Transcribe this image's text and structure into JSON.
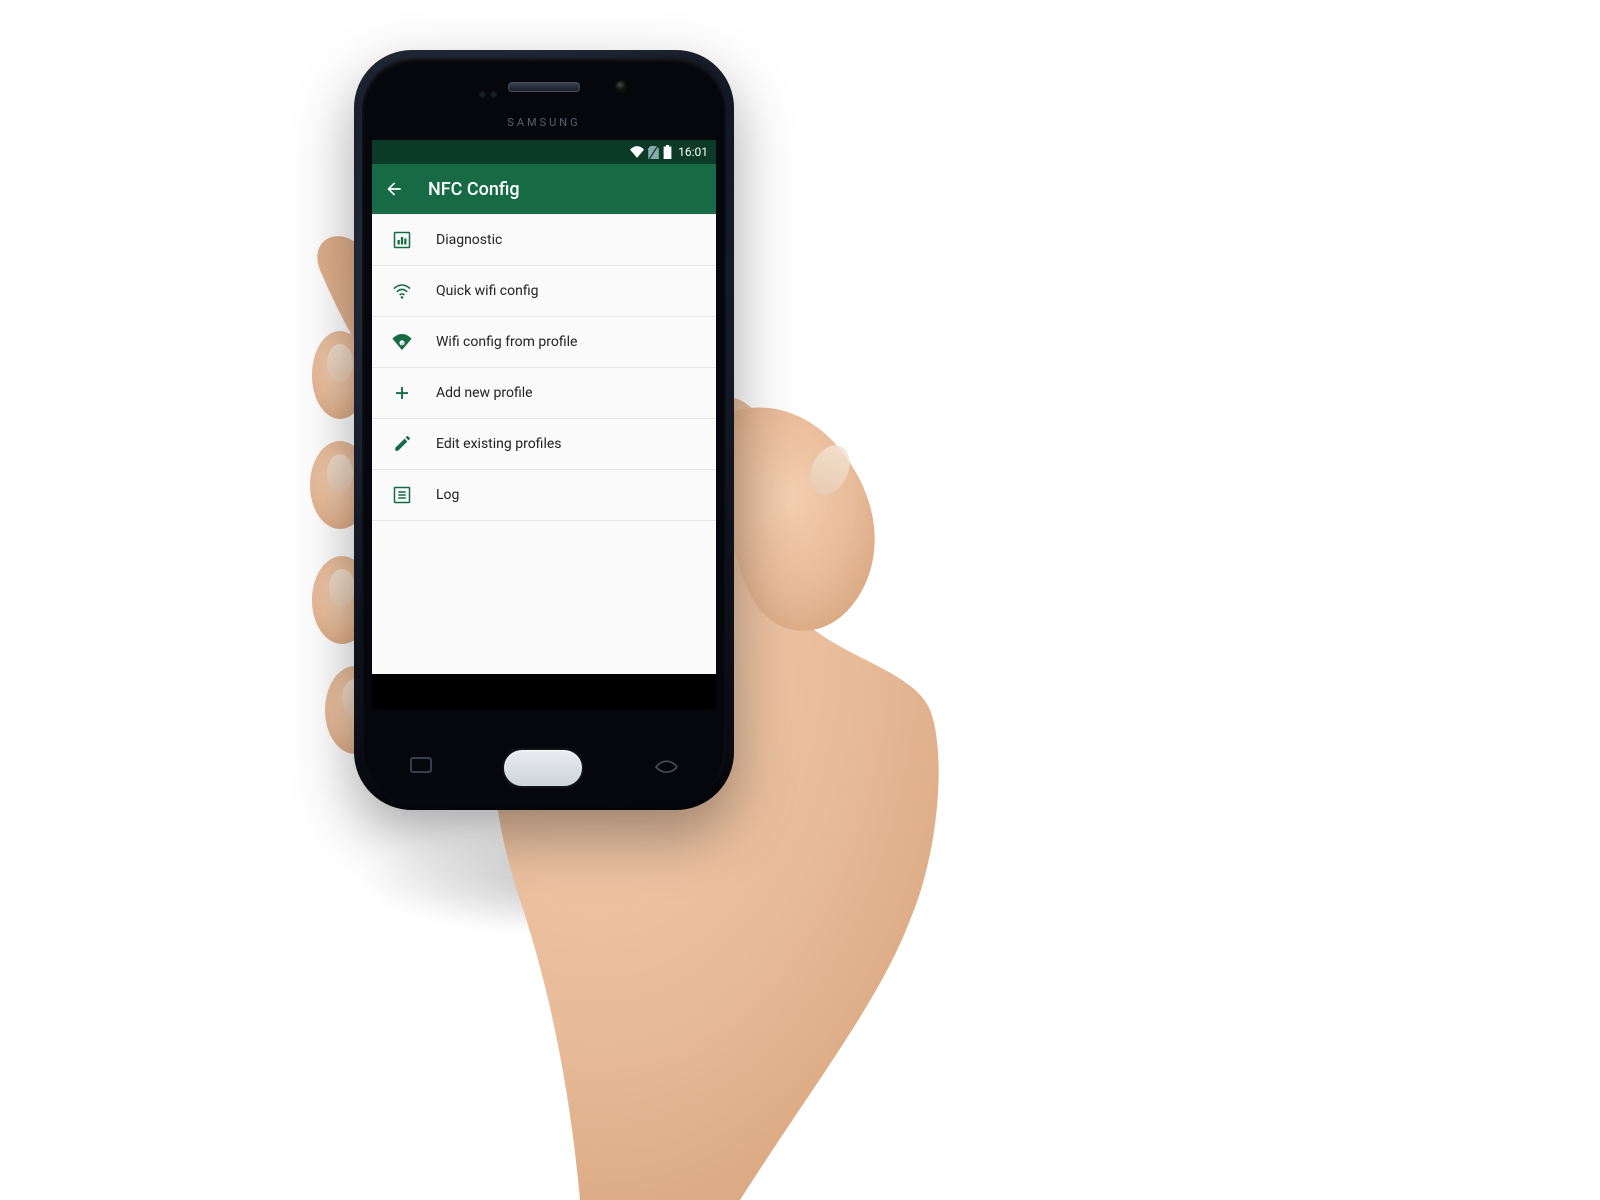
{
  "status_bar": {
    "time": "16:01"
  },
  "app_bar": {
    "title": "NFC Config"
  },
  "menu": {
    "items": [
      {
        "label": "Diagnostic",
        "icon": "chart-box"
      },
      {
        "label": "Quick wifi config",
        "icon": "wifi-outline"
      },
      {
        "label": "Wifi config from profile",
        "icon": "wifi-solid-i"
      },
      {
        "label": "Add new profile",
        "icon": "plus"
      },
      {
        "label": "Edit existing profiles",
        "icon": "pencil"
      },
      {
        "label": "Log",
        "icon": "list-box"
      }
    ]
  },
  "colors": {
    "primary": "#166b45",
    "primary_dark": "#0b3b27"
  },
  "phone_brand": "SAMSUNG"
}
